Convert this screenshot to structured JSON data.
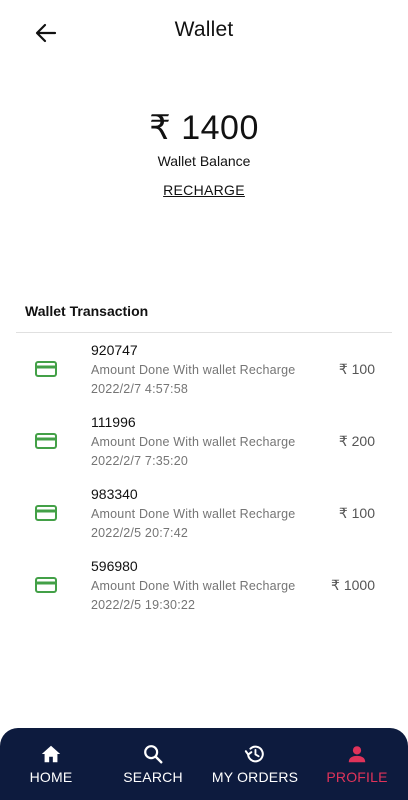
{
  "appbar": {
    "title": "Wallet",
    "back_icon": "arrow-left-icon"
  },
  "balance": {
    "amount": "₹ 1400",
    "label": "Wallet Balance",
    "recharge_label": "RECHARGE"
  },
  "transactions": {
    "title": "Wallet Transaction",
    "items": [
      {
        "id": "920747",
        "description": "Amount Done With wallet Recharge",
        "date": "2022/2/7 4:57:58",
        "amount": "₹ 100",
        "icon": "credit-card-icon"
      },
      {
        "id": "111996",
        "description": "Amount Done With wallet Recharge",
        "date": "2022/2/7 7:35:20",
        "amount": "₹ 200",
        "icon": "credit-card-icon"
      },
      {
        "id": "983340",
        "description": "Amount Done With wallet Recharge",
        "date": "2022/2/5 20:7:42",
        "amount": "₹ 100",
        "icon": "credit-card-icon"
      },
      {
        "id": "596980",
        "description": "Amount Done With wallet Recharge",
        "date": "2022/2/5 19:30:22",
        "amount": "₹ 1000",
        "icon": "credit-card-icon"
      }
    ]
  },
  "bottom_nav": {
    "items": [
      {
        "label": "HOME",
        "icon": "home-icon"
      },
      {
        "label": "SEARCH",
        "icon": "search-icon"
      },
      {
        "label": "MY ORDERS",
        "icon": "history-icon"
      },
      {
        "label": "PROFILE",
        "icon": "person-icon",
        "active": true
      }
    ]
  },
  "colors": {
    "nav_bg": "#0d1b3e",
    "active": "#e0335a",
    "card_icon": "#43a047"
  }
}
